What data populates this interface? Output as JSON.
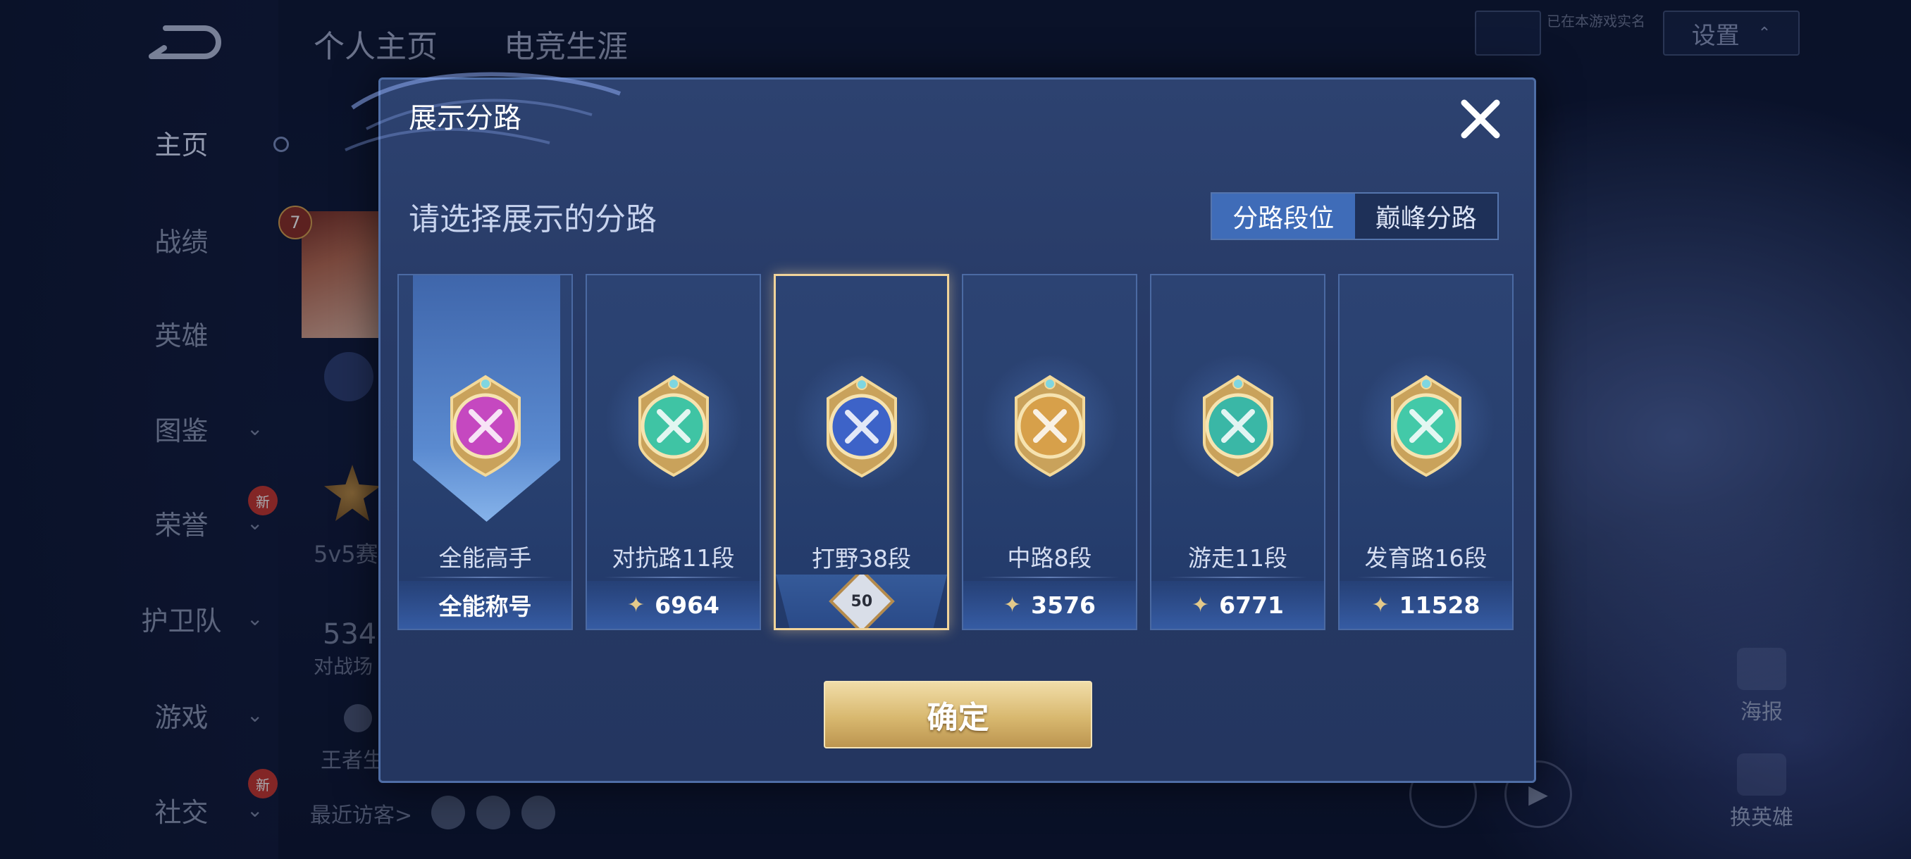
{
  "background": {
    "nav_items": [
      {
        "label": "主页",
        "chevron": false,
        "new": false
      },
      {
        "label": "战绩",
        "chevron": false,
        "new": false
      },
      {
        "label": "英雄",
        "chevron": false,
        "new": false
      },
      {
        "label": "图鉴",
        "chevron": true,
        "new": false
      },
      {
        "label": "荣誉",
        "chevron": true,
        "new": true
      },
      {
        "label": "护卫队",
        "chevron": true,
        "new": false
      },
      {
        "label": "游戏",
        "chevron": true,
        "new": false
      },
      {
        "label": "社交",
        "chevron": true,
        "new": true
      }
    ],
    "new_badge": "新",
    "tabs": [
      "个人主页",
      "电竞生涯"
    ],
    "settings_label": "设置",
    "status_hint": "已在本游戏实名",
    "profile_level": "7",
    "mode_text": "5v5赛",
    "matches_value": "534",
    "matches_label": "对战场",
    "life_label": "王者生",
    "recent_visitors": "最近访客>",
    "poster_label": "海报",
    "change_hero_label": "换英雄"
  },
  "dialog": {
    "title": "展示分路",
    "close_icon": "close-icon",
    "subtitle": "请选择展示的分路",
    "segments": {
      "active": "分路段位",
      "inactive": "巅峰分路"
    },
    "cards": [
      {
        "label": "全能高手",
        "footer": "全能称号",
        "color": "#c548c0",
        "selected": false,
        "type": "title"
      },
      {
        "label": "对抗路11段",
        "points": "6964",
        "color": "#3fc4a4",
        "selected": false,
        "type": "lane"
      },
      {
        "label": "打野38段",
        "level": "50",
        "color": "#3d63c8",
        "selected": true,
        "type": "lane"
      },
      {
        "label": "中路8段",
        "points": "3576",
        "color": "#d7a04a",
        "selected": false,
        "type": "lane"
      },
      {
        "label": "游走11段",
        "points": "6771",
        "color": "#3ab7a6",
        "selected": false,
        "type": "lane"
      },
      {
        "label": "发育路16段",
        "points": "11528",
        "color": "#43c9a8",
        "selected": false,
        "type": "lane"
      }
    ],
    "points_icon": "lane-points-icon",
    "confirm_label": "确定"
  }
}
